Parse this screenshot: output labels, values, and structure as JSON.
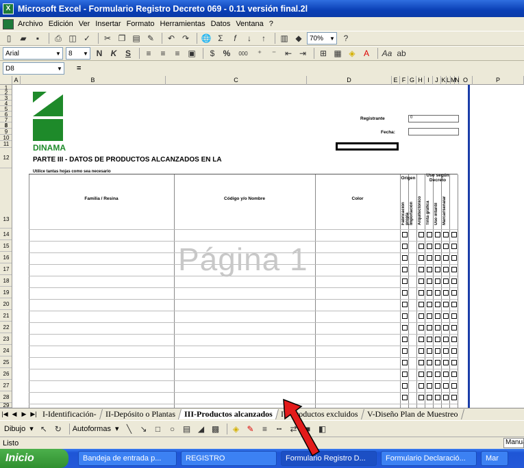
{
  "window": {
    "title": "Microsoft Excel - Formulario Registro Decreto 069 - 0.11 versión final.2l"
  },
  "menu": [
    "Archivo",
    "Edición",
    "Ver",
    "Insertar",
    "Formato",
    "Herramientas",
    "Datos",
    "Ventana",
    "?"
  ],
  "toolbar": {
    "zoom": "70%",
    "font": "Arial",
    "size": "8",
    "bold": "N",
    "italic": "K",
    "underline": "S",
    "percent": "%",
    "thousands": "000"
  },
  "formula": {
    "cellref": "D8",
    "eq": "="
  },
  "columns": [
    "A",
    "B",
    "C",
    "D",
    "E",
    "F",
    "G",
    "H",
    "I",
    "J",
    "K",
    "L",
    "M",
    "N",
    "O",
    "P"
  ],
  "rows": [
    "1",
    "2",
    "3",
    "4",
    "5",
    "6",
    "7",
    "8",
    "9",
    "10",
    "11",
    "12",
    "13",
    "14",
    "15",
    "16",
    "17",
    "18",
    "19",
    "20",
    "21",
    "22",
    "23",
    "24",
    "25",
    "26",
    "27",
    "28",
    "29"
  ],
  "sheet": {
    "org": "DINAMA",
    "registrante_label": "Registrante",
    "registrante_value": "0",
    "fecha_label": "Fecha:",
    "parte_title": "PARTE III - DATOS DE PRODUCTOS ALCANZADOS EN LA",
    "note": "Utilice tantas hojas como sea necesario",
    "col_familia": "Familia / Resina",
    "col_codigo": "Código y/o Nombre",
    "col_color": "Color",
    "origen": "Origen",
    "uso_header": "Uso según Decreto",
    "vertical_labels": [
      "Fabricación propia",
      "Importación",
      "Arquitectónico",
      "Tinta gráfica",
      "Uso infantil",
      "Marcar/señalar"
    ],
    "watermark": "Página 1"
  },
  "tabs": [
    "I-Identificación-",
    "II-Depósito o Plantas",
    "III-Productos alcanzados",
    "IV-Productos excluidos",
    "V-Diseño Plan de Muestreo"
  ],
  "drawbar": {
    "dibujo": "Dibujo",
    "autoformas": "Autoformas"
  },
  "status": {
    "text": "Listo",
    "mode": "Manual"
  },
  "taskbar": {
    "start": "Inicio",
    "items": [
      "Bandeja de entrada p...",
      "REGISTRO",
      "Formulario Registro D...",
      "Formulario Declaració...",
      "Mar"
    ]
  },
  "colors": {
    "accent": "#1e8a2a",
    "title": "#0a3fb5",
    "arrow": "#e31b1b"
  }
}
